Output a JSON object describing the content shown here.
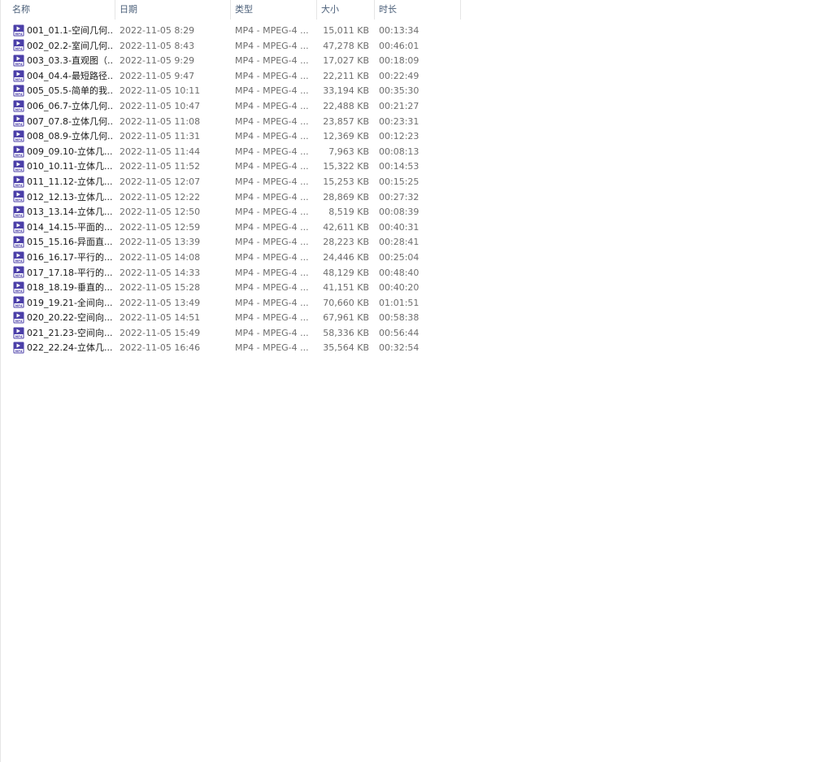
{
  "columns": {
    "name": "名称",
    "date": "日期",
    "type": "类型",
    "size": "大小",
    "duration": "时长",
    "sort_indicator": "^"
  },
  "accent_color": "#4b3fa8",
  "files": [
    {
      "name": "001_01.1-空间几何...",
      "date": "2022-11-05 8:29",
      "type": "MP4 - MPEG-4 ...",
      "size": "15,011 KB",
      "duration": "00:13:34"
    },
    {
      "name": "002_02.2-室间几何...",
      "date": "2022-11-05 8:43",
      "type": "MP4 - MPEG-4 ...",
      "size": "47,278 KB",
      "duration": "00:46:01"
    },
    {
      "name": "003_03.3-直观图（...",
      "date": "2022-11-05 9:29",
      "type": "MP4 - MPEG-4 ...",
      "size": "17,027 KB",
      "duration": "00:18:09"
    },
    {
      "name": "004_04.4-最短路径...",
      "date": "2022-11-05 9:47",
      "type": "MP4 - MPEG-4 ...",
      "size": "22,211 KB",
      "duration": "00:22:49"
    },
    {
      "name": "005_05.5-简单的我...",
      "date": "2022-11-05 10:11",
      "type": "MP4 - MPEG-4 ...",
      "size": "33,194 KB",
      "duration": "00:35:30"
    },
    {
      "name": "006_06.7-立体几何...",
      "date": "2022-11-05 10:47",
      "type": "MP4 - MPEG-4 ...",
      "size": "22,488 KB",
      "duration": "00:21:27"
    },
    {
      "name": "007_07.8-立体几何...",
      "date": "2022-11-05 11:08",
      "type": "MP4 - MPEG-4 ...",
      "size": "23,857 KB",
      "duration": "00:23:31"
    },
    {
      "name": "008_08.9-立体几何...",
      "date": "2022-11-05 11:31",
      "type": "MP4 - MPEG-4 ...",
      "size": "12,369 KB",
      "duration": "00:12:23"
    },
    {
      "name": "009_09.10-立体几...",
      "date": "2022-11-05 11:44",
      "type": "MP4 - MPEG-4 ...",
      "size": "7,963 KB",
      "duration": "00:08:13"
    },
    {
      "name": "010_10.11-立体几...",
      "date": "2022-11-05 11:52",
      "type": "MP4 - MPEG-4 ...",
      "size": "15,322 KB",
      "duration": "00:14:53"
    },
    {
      "name": "011_11.12-立体几...",
      "date": "2022-11-05 12:07",
      "type": "MP4 - MPEG-4 ...",
      "size": "15,253 KB",
      "duration": "00:15:25"
    },
    {
      "name": "012_12.13-立体几...",
      "date": "2022-11-05 12:22",
      "type": "MP4 - MPEG-4 ...",
      "size": "28,869 KB",
      "duration": "00:27:32"
    },
    {
      "name": "013_13.14-立体几...",
      "date": "2022-11-05 12:50",
      "type": "MP4 - MPEG-4 ...",
      "size": "8,519 KB",
      "duration": "00:08:39"
    },
    {
      "name": "014_14.15-平面的...",
      "date": "2022-11-05 12:59",
      "type": "MP4 - MPEG-4 ...",
      "size": "42,611 KB",
      "duration": "00:40:31"
    },
    {
      "name": "015_15.16-异面直...",
      "date": "2022-11-05 13:39",
      "type": "MP4 - MPEG-4 ...",
      "size": "28,223 KB",
      "duration": "00:28:41"
    },
    {
      "name": "016_16.17-平行的...",
      "date": "2022-11-05 14:08",
      "type": "MP4 - MPEG-4 ...",
      "size": "24,446 KB",
      "duration": "00:25:04"
    },
    {
      "name": "017_17.18-平行的...",
      "date": "2022-11-05 14:33",
      "type": "MP4 - MPEG-4 ...",
      "size": "48,129 KB",
      "duration": "00:48:40"
    },
    {
      "name": "018_18.19-垂直的...",
      "date": "2022-11-05 15:28",
      "type": "MP4 - MPEG-4 ...",
      "size": "41,151 KB",
      "duration": "00:40:20"
    },
    {
      "name": "019_19.21-全间向...",
      "date": "2022-11-05 13:49",
      "type": "MP4 - MPEG-4 ...",
      "size": "70,660 KB",
      "duration": "01:01:51"
    },
    {
      "name": "020_20.22-空间向...",
      "date": "2022-11-05 14:51",
      "type": "MP4 - MPEG-4 ...",
      "size": "67,961 KB",
      "duration": "00:58:38"
    },
    {
      "name": "021_21.23-空间向...",
      "date": "2022-11-05 15:49",
      "type": "MP4 - MPEG-4 ...",
      "size": "58,336 KB",
      "duration": "00:56:44"
    },
    {
      "name": "022_22.24-立体几...",
      "date": "2022-11-05 16:46",
      "type": "MP4 - MPEG-4 ...",
      "size": "35,564 KB",
      "duration": "00:32:54"
    }
  ]
}
